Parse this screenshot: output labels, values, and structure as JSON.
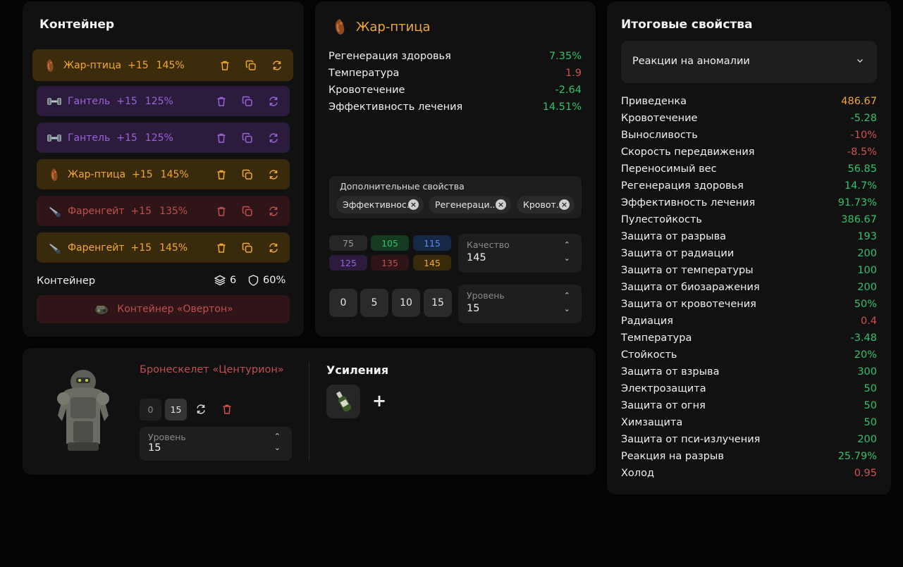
{
  "container_panel": {
    "title": "Контейнер",
    "items": [
      {
        "name": "Жар-птица",
        "level": "+15",
        "percent": "145%",
        "color": "orange",
        "icon": "firebird-artifact-icon"
      },
      {
        "name": "Гантель",
        "level": "+15",
        "percent": "125%",
        "color": "purple",
        "icon": "dumbbell-artifact-icon"
      },
      {
        "name": "Гантель",
        "level": "+15",
        "percent": "125%",
        "color": "purple",
        "icon": "dumbbell-artifact-icon"
      },
      {
        "name": "Жар-птица",
        "level": "+15",
        "percent": "145%",
        "color": "orange",
        "icon": "firebird-artifact-icon"
      },
      {
        "name": "Фаренгейт",
        "level": "+15",
        "percent": "135%",
        "color": "red",
        "icon": "fahrenheit-artifact-icon"
      },
      {
        "name": "Фаренгейт",
        "level": "+15",
        "percent": "145%",
        "color": "orange",
        "icon": "fahrenheit-artifact-icon"
      }
    ],
    "footer_label": "Контейнер",
    "slots_count": "6",
    "protection": "60%",
    "container_name": "Контейнер «Овертон»"
  },
  "artifact_panel": {
    "title": "Жар-птица",
    "stats": [
      {
        "label": "Регенерация здоровья",
        "value": "7.35%",
        "tone": "green"
      },
      {
        "label": "Температура",
        "value": "1.9",
        "tone": "red"
      },
      {
        "label": "Кровотечение",
        "value": "-2.64",
        "tone": "green"
      },
      {
        "label": "Эффективность лечения",
        "value": "14.51%",
        "tone": "green"
      }
    ],
    "extra_title": "Дополнительные свойства",
    "extra_chips": [
      "Эффективнос...",
      "Регенераци...",
      "Кровот..."
    ],
    "quality_buttons": [
      {
        "label": "75",
        "tone": "gray"
      },
      {
        "label": "105",
        "tone": "green"
      },
      {
        "label": "115",
        "tone": "blue"
      },
      {
        "label": "125",
        "tone": "purple"
      },
      {
        "label": "135",
        "tone": "red"
      },
      {
        "label": "145",
        "tone": "orange"
      }
    ],
    "quality_label": "Качество",
    "quality_value": "145",
    "level_buttons": [
      "0",
      "5",
      "10",
      "15"
    ],
    "level_label": "Уровень",
    "level_value": "15"
  },
  "armor_panel": {
    "name": "Бронескелет «Центурион»",
    "level_buttons": [
      "0",
      "15"
    ],
    "level_label": "Уровень",
    "level_value": "15",
    "boosts_title": "Усиления",
    "add_label": "+"
  },
  "summary_panel": {
    "title": "Итоговые свойства",
    "dropdown_value": "Реакции на аномалии",
    "stats": [
      {
        "label": "Приведенка",
        "value": "486.67",
        "tone": "orange"
      },
      {
        "label": "Кровотечение",
        "value": "-5.28",
        "tone": "green"
      },
      {
        "label": "Выносливость",
        "value": "-10%",
        "tone": "red"
      },
      {
        "label": "Скорость передвижения",
        "value": "-8.5%",
        "tone": "red"
      },
      {
        "label": "Переносимый вес",
        "value": "56.85",
        "tone": "green"
      },
      {
        "label": "Регенерация здоровья",
        "value": "14.7%",
        "tone": "green"
      },
      {
        "label": "Эффективность лечения",
        "value": "91.73%",
        "tone": "green"
      },
      {
        "label": "Пулестойкость",
        "value": "386.67",
        "tone": "green"
      },
      {
        "label": "Защита от разрыва",
        "value": "193",
        "tone": "green"
      },
      {
        "label": "Защита от радиации",
        "value": "200",
        "tone": "green"
      },
      {
        "label": "Защита от температуры",
        "value": "100",
        "tone": "green"
      },
      {
        "label": "Защита от биозаражения",
        "value": "200",
        "tone": "green"
      },
      {
        "label": "Защита от кровотечения",
        "value": "50%",
        "tone": "green"
      },
      {
        "label": "Радиация",
        "value": "0.4",
        "tone": "red"
      },
      {
        "label": "Температура",
        "value": "-3.48",
        "tone": "green"
      },
      {
        "label": "Стойкость",
        "value": "20%",
        "tone": "green"
      },
      {
        "label": "Защита от взрыва",
        "value": "300",
        "tone": "green"
      },
      {
        "label": "Электрозащита",
        "value": "50",
        "tone": "green"
      },
      {
        "label": "Защита от огня",
        "value": "50",
        "tone": "green"
      },
      {
        "label": "Химзащита",
        "value": "50",
        "tone": "green"
      },
      {
        "label": "Защита от пси-излучения",
        "value": "200",
        "tone": "green"
      },
      {
        "label": "Реакция на разрыв",
        "value": "25.79%",
        "tone": "green"
      },
      {
        "label": "Холод",
        "value": "0.95",
        "tone": "red"
      }
    ]
  },
  "colors": {
    "orange": "#f0a833",
    "purple": "#9a63d9",
    "red": "#bf4f51",
    "green": "#2ec46a",
    "background": "#040404",
    "panel": "#111111"
  }
}
